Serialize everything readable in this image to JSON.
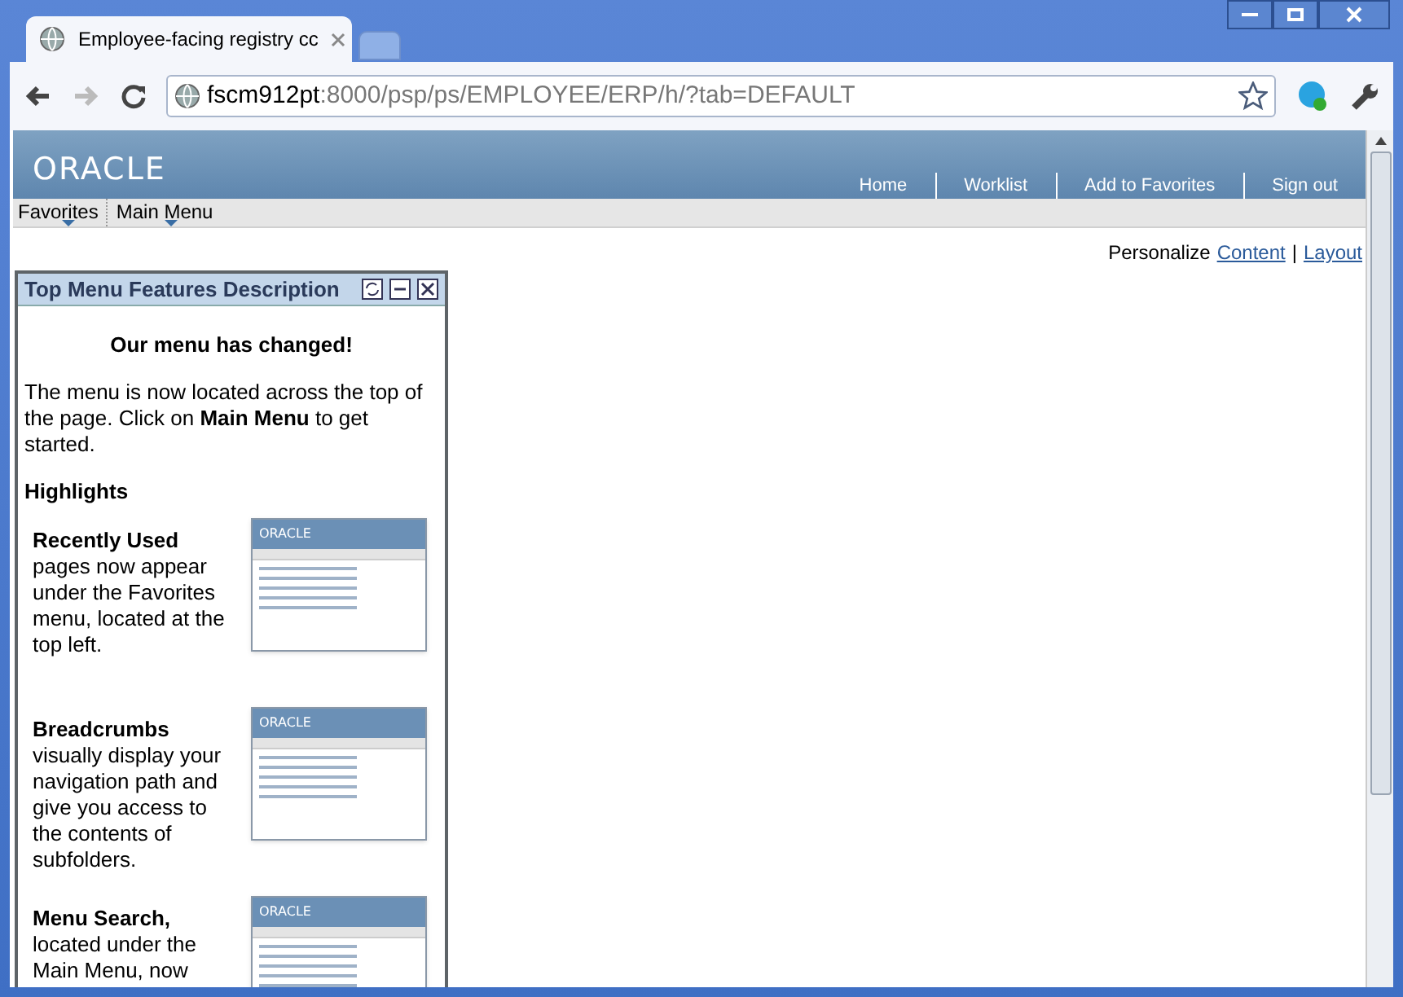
{
  "browser": {
    "tab_title": "Employee-facing registry cc",
    "address_host": "fscm912pt",
    "address_path": ":8000/psp/ps/EMPLOYEE/ERP/h/?tab=DEFAULT"
  },
  "header": {
    "logo": "ORACLE",
    "links": [
      "Home",
      "Worklist",
      "Add to Favorites",
      "Sign out"
    ]
  },
  "menu_bar": [
    "Favorites",
    "Main Menu"
  ],
  "personalize": {
    "label": "Personalize",
    "links": [
      "Content",
      "Layout"
    ],
    "separator": "|"
  },
  "pagelet": {
    "title": "Top Menu Features Description",
    "heading": "Our menu has changed!",
    "intro": "The menu is now located across the top of the page. Click on **Main Menu** to get started.",
    "highlights_title": "Highlights",
    "highlights": [
      {
        "title": "Recently Used",
        "text": "pages now appear under the Favorites menu, located at the top left.",
        "thumbnail_logo": "ORACLE"
      },
      {
        "title": "Breadcrumbs",
        "text": "visually display your navigation path and give you access to the contents of subfolders.",
        "thumbnail_logo": "ORACLE"
      },
      {
        "title": "Menu Search,",
        "text": "located under the Main Menu, now",
        "thumbnail_logo": "ORACLE"
      }
    ]
  }
}
